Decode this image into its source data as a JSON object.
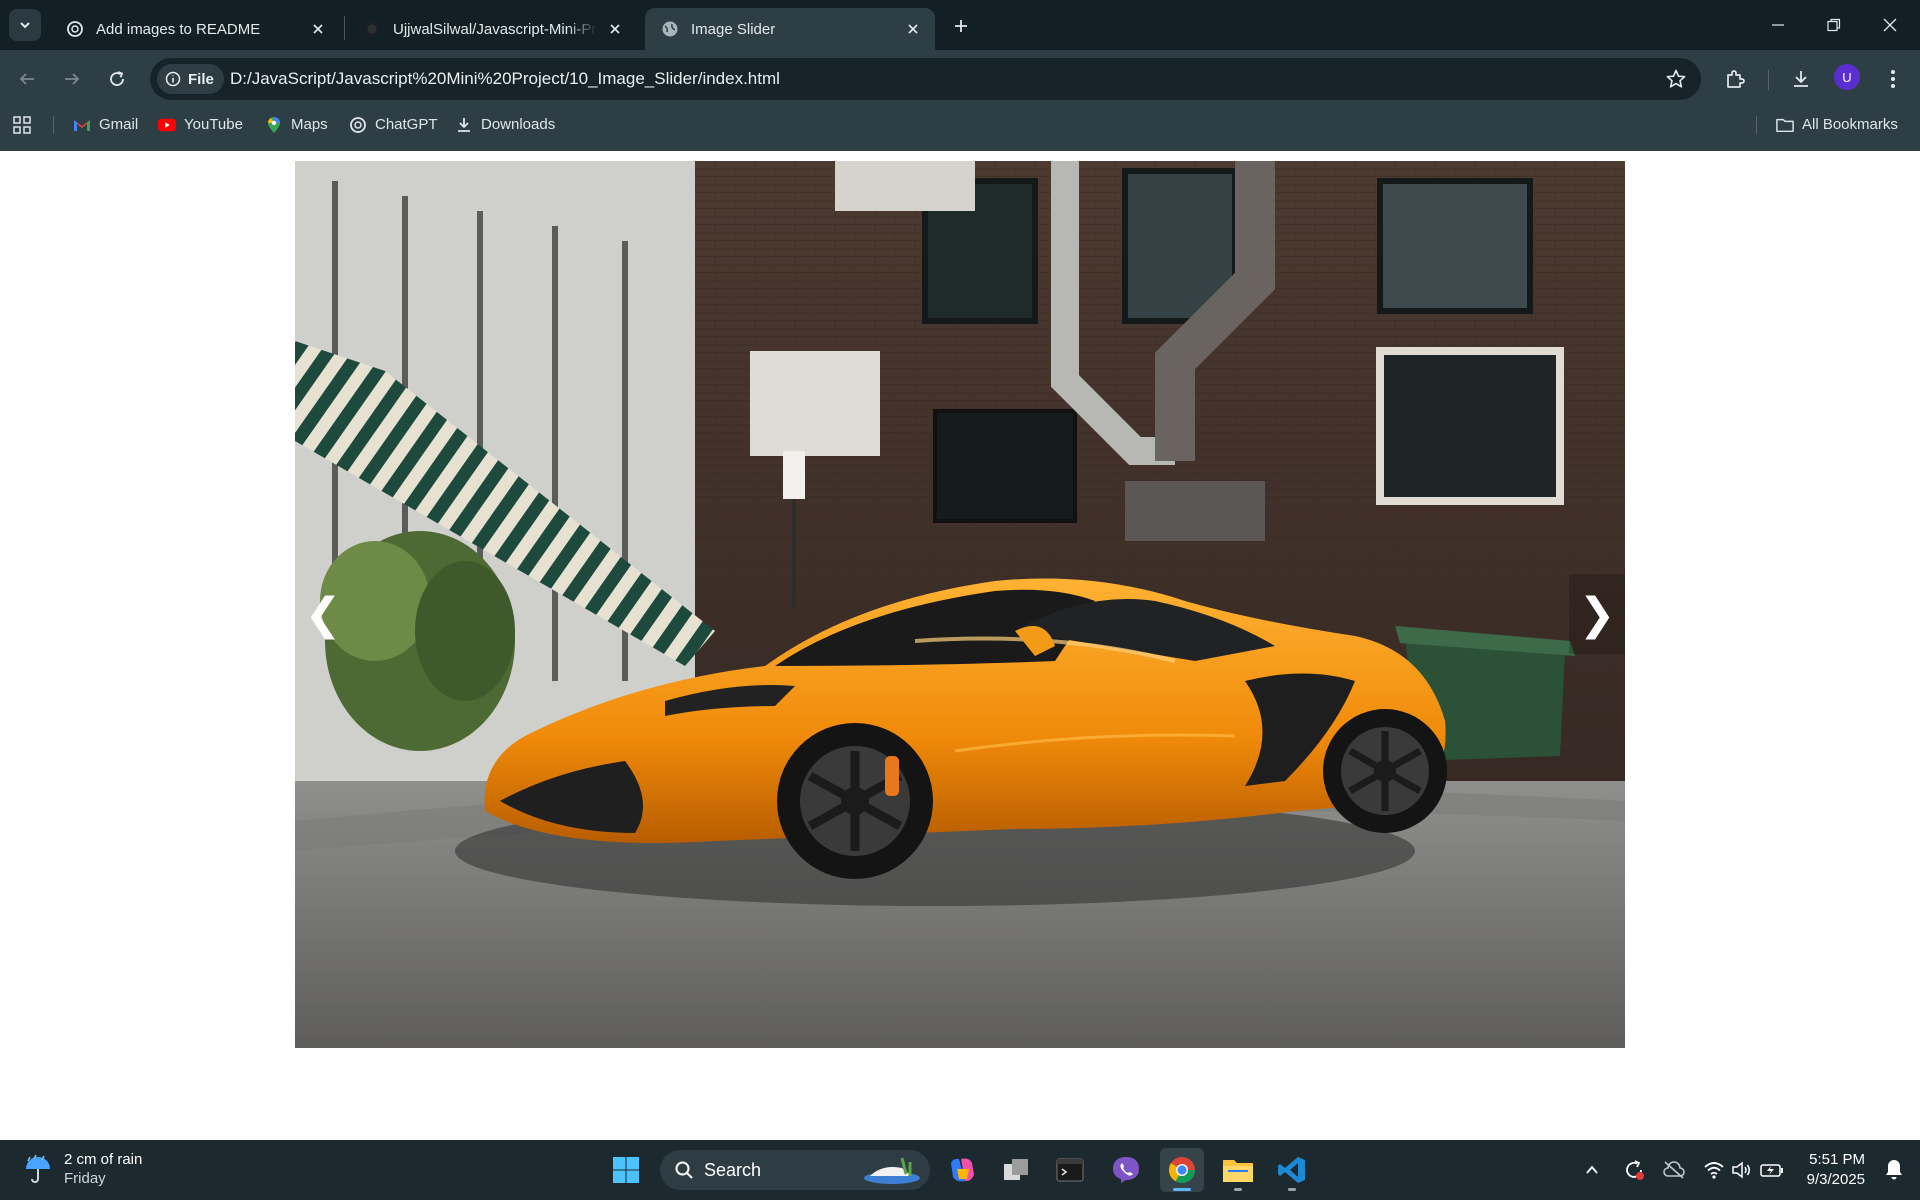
{
  "browser": {
    "tabs": [
      {
        "title": "Add images to README",
        "icon": "chatgpt-icon",
        "active": false
      },
      {
        "title": "UjjwalSilwal/Javascript-Mini-Pro",
        "icon": "github-icon",
        "active": false
      },
      {
        "title": "Image Slider",
        "icon": "globe-icon",
        "active": true
      }
    ],
    "address": {
      "scheme_label": "File",
      "url": "D:/JavaScript/Javascript%20Mini%20Project/10_Image_Slider/index.html"
    },
    "profile_initial": "U",
    "bookmarks": [
      {
        "label": "Gmail",
        "icon": "gmail-icon"
      },
      {
        "label": "YouTube",
        "icon": "youtube-icon"
      },
      {
        "label": "Maps",
        "icon": "maps-icon"
      },
      {
        "label": "ChatGPT",
        "icon": "chatgpt-icon"
      },
      {
        "label": "Downloads",
        "icon": "download-icon"
      }
    ],
    "all_bookmarks_label": "All Bookmarks"
  },
  "slider": {
    "prev_label": "❮",
    "next_label": "❯",
    "current_image": "orange-sports-car-in-alley"
  },
  "taskbar": {
    "weather": {
      "line1": "2 cm of rain",
      "line2": "Friday"
    },
    "search_placeholder": "Search",
    "time": "5:51 PM",
    "date": "9/3/2025"
  }
}
